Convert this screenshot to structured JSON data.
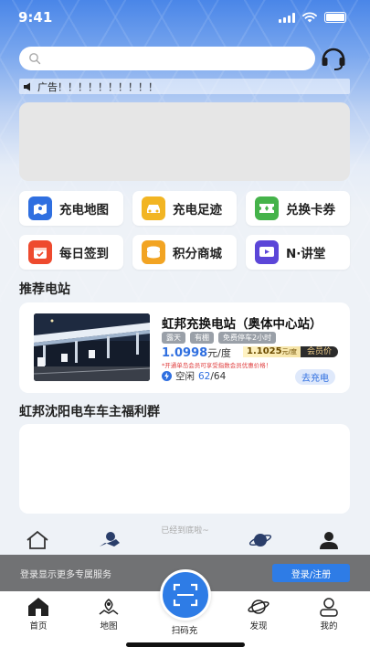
{
  "status": {
    "time": "9:41"
  },
  "search": {
    "placeholder": ""
  },
  "notice": {
    "text": "广告！！！！！！！！！！"
  },
  "quick_actions": [
    {
      "label": "充电地图",
      "icon": "map-icon",
      "color": "#2f6fe0"
    },
    {
      "label": "充电足迹",
      "icon": "car-icon",
      "color": "#f2b523"
    },
    {
      "label": "兑换卡券",
      "icon": "ticket-icon",
      "color": "#45b34a"
    },
    {
      "label": "每日签到",
      "icon": "calendar-icon",
      "color": "#ee4a2e"
    },
    {
      "label": "积分商城",
      "icon": "coins-icon",
      "color": "#f2a423"
    },
    {
      "label": "N·讲堂",
      "icon": "video-icon",
      "color": "#5b46d8"
    }
  ],
  "recommend": {
    "title": "推荐电站",
    "station": {
      "name": "虹邦充换电站（奥体中心站）",
      "tags": [
        "露天",
        "有棚",
        "免费停车2小时"
      ],
      "price": "1.0998",
      "price_unit": "元/度",
      "member_price": "1.1025",
      "member_unit": "元/度",
      "member_label": "会员价",
      "hint": "*开通单岛会员可享受指数会员优惠价格！",
      "idle_label": "空闲",
      "idle_count": "62",
      "total_count": "/64",
      "go_label": "去充电"
    }
  },
  "group": {
    "title": "虹邦沈阳电车车主福利群"
  },
  "bottom_tip": "已经到底啦~",
  "login_bar": {
    "text": "登录显示更多专属服务",
    "button": "登录/注册"
  },
  "tabs": [
    {
      "label": "首页",
      "icon": "home-icon"
    },
    {
      "label": "地图",
      "icon": "map-pin-icon"
    },
    {
      "label": "扫码充",
      "icon": "scan-icon"
    },
    {
      "label": "发现",
      "icon": "planet-icon"
    },
    {
      "label": "我的",
      "icon": "user-icon"
    }
  ]
}
